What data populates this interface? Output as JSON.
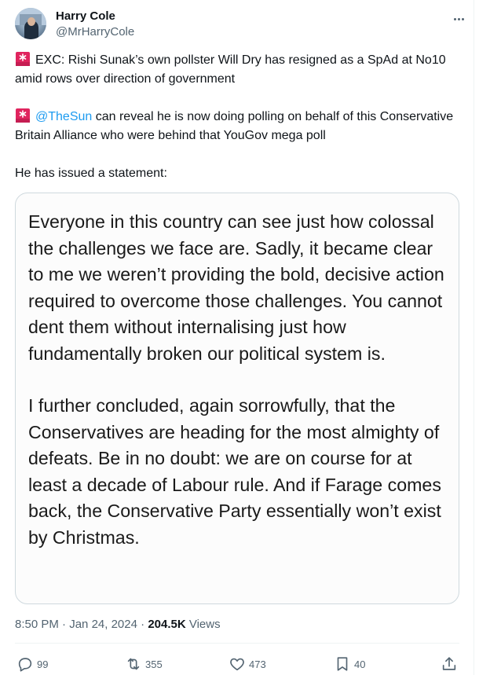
{
  "author": {
    "display_name": "Harry Cole",
    "handle": "@MrHarryCole"
  },
  "tweet": {
    "p1_emoji": "siren-icon",
    "p1_text": "EXC: Rishi Sunak’s own pollster Will Dry has resigned as a SpAd at No10 amid rows over direction of government",
    "p2_emoji": "siren-icon",
    "p2_mention": "@TheSun",
    "p2_text": " can reveal he is now doing polling on behalf of this Conservative Britain Alliance who were behind that YouGov mega poll",
    "p3_text": "He has issued a statement:"
  },
  "statement": {
    "para1": "Everyone in this country can see just how colossal the challenges we face are. Sadly, it became clear to me we weren’t providing the bold, decisive action required to overcome those challenges. You cannot dent them without internalising just how fundamentally broken our political system is.",
    "para2": "I further concluded, again sorrowfully, that the Conservatives are heading for the most almighty of defeats. Be in no doubt: we are on course for at least a decade of Labour rule. And if Farage comes back, the Conservative Party essentially won’t exist by Christmas."
  },
  "meta": {
    "time": "8:50 PM",
    "separator1": " · ",
    "date": "Jan 24, 2024",
    "separator2": " · ",
    "views_count": "204.5K",
    "views_label": " Views"
  },
  "actions": {
    "replies": "99",
    "reposts": "355",
    "likes": "473",
    "bookmarks": "40"
  },
  "colors": {
    "accent": "#1d9bf0",
    "muted_text": "#536471",
    "siren_red": "#e0245e"
  }
}
